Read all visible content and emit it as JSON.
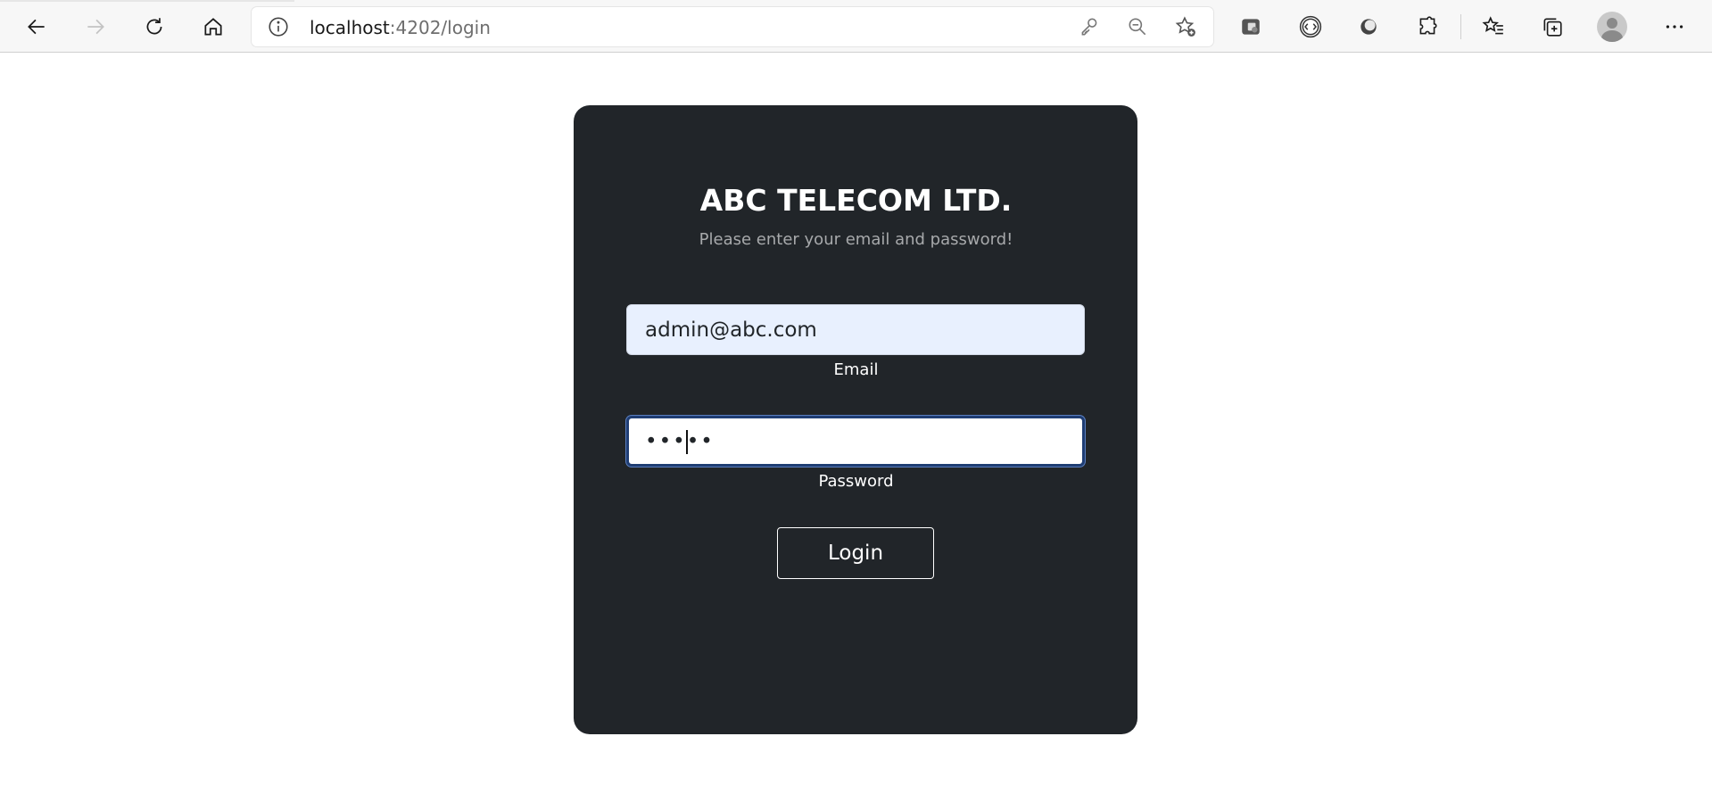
{
  "browser": {
    "url_host": "localhost",
    "url_rest": ":4202/login",
    "icons": {
      "back": "back-arrow-icon",
      "forward": "forward-arrow-icon",
      "refresh": "refresh-icon",
      "home": "home-icon",
      "site_info": "info-icon",
      "password_key": "key-icon",
      "zoom": "zoom-out-icon",
      "favorite": "add-favorite-icon",
      "extension_1": "extension-icon",
      "extension_2": "devtools-icon",
      "extension_3": "circle-extension-icon",
      "extensions": "puzzle-icon",
      "favorites": "favorites-icon",
      "collections": "collections-icon",
      "profile": "profile-icon",
      "menu": "more-icon"
    }
  },
  "login": {
    "title": "ABC TELECOM LTD.",
    "subtitle": "Please enter your email and password!",
    "email_value": "admin@abc.com",
    "email_label": "Email",
    "password_value": "•••••",
    "password_label": "Password",
    "login_button": "Login"
  },
  "colors": {
    "card_background": "#212529",
    "email_autofill_bg": "#e8f0fe",
    "focus_border": "#1f3d73"
  }
}
